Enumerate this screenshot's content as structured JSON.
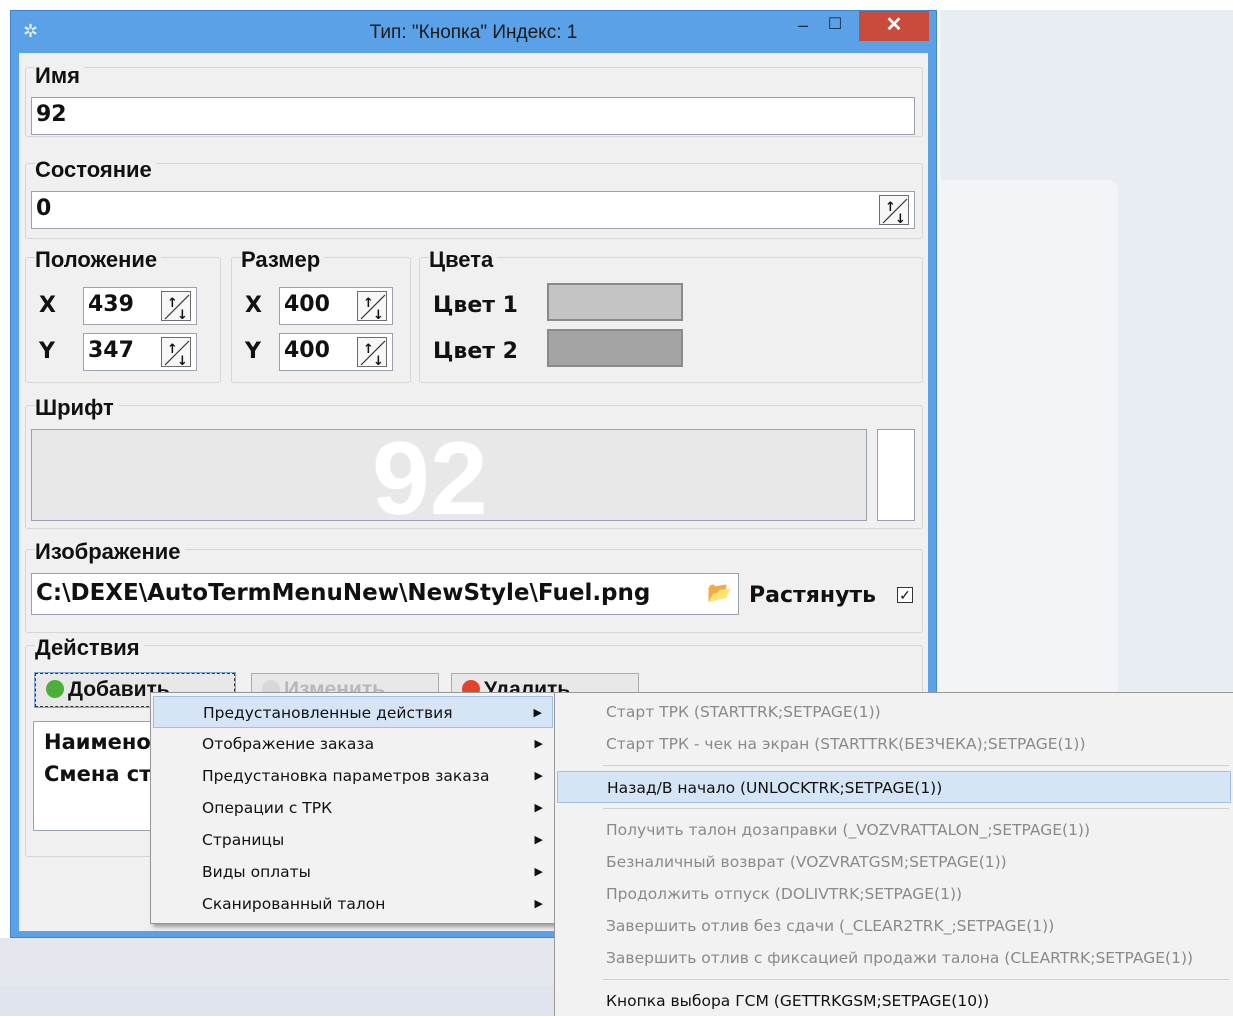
{
  "window": {
    "title": "Тип: \"Кнопка\" Индекс: 1",
    "min_glyph": "–",
    "max_glyph": "☐",
    "close_glyph": "✕"
  },
  "name": {
    "label": "Имя",
    "value": "92"
  },
  "state": {
    "label": "Состояние",
    "value": "0"
  },
  "position": {
    "label": "Положение",
    "x_label": "X",
    "x_value": "439",
    "y_label": "Y",
    "y_value": "347"
  },
  "size": {
    "label": "Размер",
    "x_label": "X",
    "x_value": "400",
    "y_label": "Y",
    "y_value": "400"
  },
  "colors": {
    "label": "Цвета",
    "color1_label": "Цвет 1",
    "color2_label": "Цвет 2",
    "color1": "#c4c4c4",
    "color2": "#a4a4a4"
  },
  "font": {
    "label": "Шрифт",
    "preview_text": "92"
  },
  "image": {
    "label": "Изображение",
    "path": "C:\\DEXE\\AutoTermMenuNew\\NewStyle\\Fuel.png",
    "stretch_label": "Растянуть",
    "stretch_checked": "✓"
  },
  "actions": {
    "label": "Действия",
    "add_label": "Добавить",
    "edit_label": "Изменить",
    "delete_label": "Удалить",
    "list": [
      "Наименование",
      "Смена ст"
    ]
  },
  "context_menu": {
    "items": [
      {
        "label": "Предустановленные действия"
      },
      {
        "label": "Отображение заказа"
      },
      {
        "label": "Предустановка параметров заказа"
      },
      {
        "label": "Операции с ТРК"
      },
      {
        "label": "Страницы"
      },
      {
        "label": "Виды оплаты"
      },
      {
        "label": "Сканированный талон"
      }
    ],
    "arrow": "▶"
  },
  "submenu": {
    "items": [
      {
        "label": "Старт ТРК (STARTTRK;SETPAGE(1))"
      },
      {
        "label": "Старт ТРК - чек на экран (STARTTRK(БЕЗЧЕКА);SETPAGE(1))"
      },
      {
        "label": "Назад/В начало (UNLOCKTRK;SETPAGE(1))"
      },
      {
        "label": "Получить талон дозаправки (_VOZVRATTALON_;SETPAGE(1))"
      },
      {
        "label": "Безналичный возврат (VOZVRATGSM;SETPAGE(1))"
      },
      {
        "label": "Продолжить отпуск (DOLIVTRK;SETPAGE(1))"
      },
      {
        "label": "Завершить отлив без сдачи (_CLEAR2TRK_;SETPAGE(1))"
      },
      {
        "label": "Завершить отлив с фиксацией продажи талона (CLEARTRK;SETPAGE(1))"
      },
      {
        "label": "Кнопка выбора ГСМ (GETTRKGSM;SETPAGE(10))"
      }
    ]
  }
}
